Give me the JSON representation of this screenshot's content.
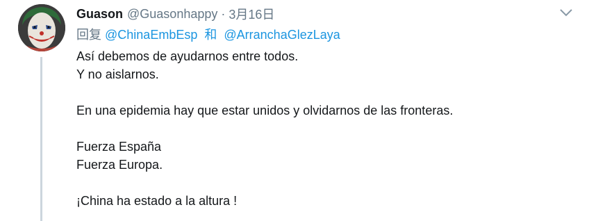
{
  "tweet": {
    "author_name": "Guason",
    "author_handle": "@Guasonhappy",
    "separator": "·",
    "date": "3月16日",
    "reply_label": "回复",
    "reply_mentions": [
      "@ChinaEmbEsp",
      "@ArranchaGlezLaya"
    ],
    "reply_conjunction": "和",
    "lines": [
      "Así debemos de ayudarnos entre todos.",
      "Y no aislarnos.",
      "",
      "En una epidemia hay que estar unidos y olvidarnos de las fronteras.",
      "",
      "Fuerza España",
      "Fuerza Europa.",
      "",
      "¡China ha estado a la altura !"
    ]
  },
  "icons": {
    "avatar": "joker-avatar",
    "menu": "chevron-down-icon"
  },
  "colors": {
    "name": "#14171a",
    "muted": "#657786",
    "link": "#1b95e0",
    "thread_line": "#ccd6dd"
  }
}
